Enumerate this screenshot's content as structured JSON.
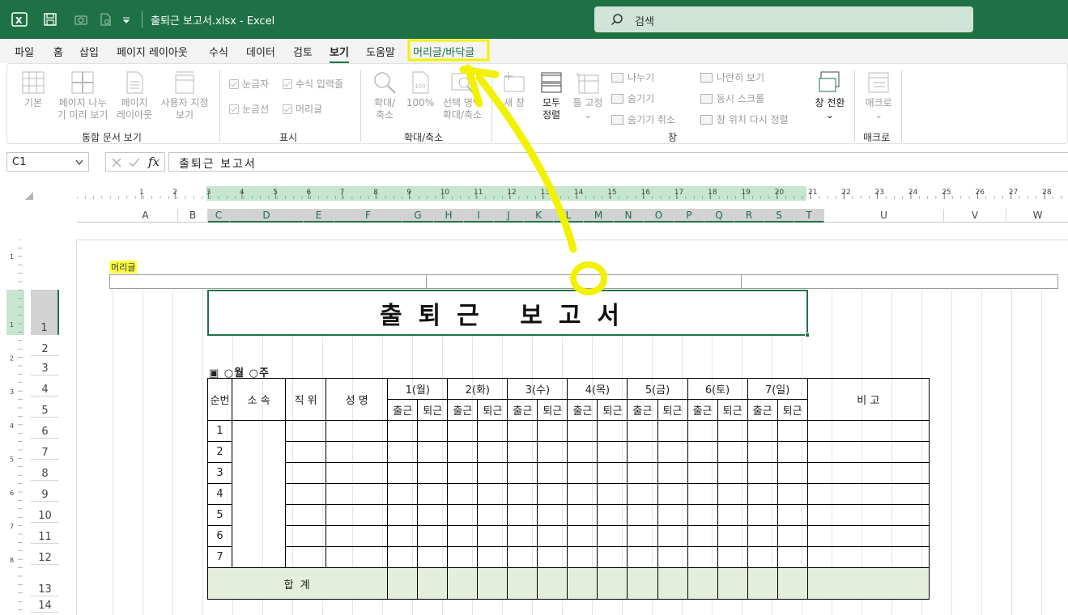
{
  "app": {
    "title": "출퇴근 보고서.xlsx  -  Excel",
    "search_placeholder": "검색"
  },
  "tabs": [
    "파일",
    "홈",
    "삽입",
    "페이지 레이아웃",
    "수식",
    "데이터",
    "검토",
    "보기",
    "도움말",
    "머리글/바닥글"
  ],
  "active_tab": "보기",
  "ribbon": {
    "group_workbook_views": {
      "label": "통합 문서 보기",
      "normal": "기본",
      "page_break_1": "페이지 나누",
      "page_break_2": "기 미리 보기",
      "page_layout_1": "페이지",
      "page_layout_2": "레이아웃",
      "custom_1": "사용자 지정",
      "custom_2": "보기"
    },
    "group_show": {
      "label": "표시",
      "ruler": "눈금자",
      "formula_bar": "수식 입력줄",
      "gridlines": "눈금선",
      "headings": "머리글"
    },
    "group_zoom": {
      "label": "확대/축소",
      "zoom_1": "확대/",
      "zoom_2": "축소",
      "zoom100": "100%",
      "zoom_sel_1": "선택 영역",
      "zoom_sel_2": "확대/축소"
    },
    "group_window": {
      "label": "창",
      "new_window": "새 창",
      "arrange_1": "모두",
      "arrange_2": "정렬",
      "freeze": "틀 고정",
      "split": "나누기",
      "hide": "숨기기",
      "unhide": "숨기기 취소",
      "side_by_side": "나란히 보기",
      "sync_scroll": "동시 스크롤",
      "reset_pos": "창 위치 다시 정렬",
      "switch": "창 전환"
    },
    "group_macro": {
      "label": "매크로",
      "macros": "매크로"
    }
  },
  "formula_bar": {
    "name_box": "C1",
    "formula": "출퇴근   보고서"
  },
  "columns": [
    "A",
    "B",
    "C",
    "D",
    "E",
    "F",
    "G",
    "H",
    "I",
    "J",
    "K",
    "L",
    "M",
    "N",
    "O",
    "P",
    "Q",
    "R",
    "S",
    "T",
    "U",
    "V",
    "W"
  ],
  "ruler_h": [
    "1",
    "2",
    "3",
    "4",
    "5",
    "6",
    "7",
    "8",
    "9",
    "10",
    "11",
    "12",
    "13",
    "14",
    "15",
    "16",
    "17",
    "18",
    "19",
    "20",
    "21",
    "22",
    "23",
    "24",
    "25",
    "26",
    "27",
    "28"
  ],
  "ruler_v": [
    "1",
    "1",
    "2",
    "3",
    "4",
    "5",
    "6",
    "7",
    "8"
  ],
  "rows": [
    "1",
    "2",
    "3",
    "4",
    "5",
    "6",
    "7",
    "8",
    "9",
    "10",
    "11",
    "12",
    "13",
    "14"
  ],
  "sheet": {
    "header_label": "머리글",
    "title": "출퇴근   보고서",
    "week_text": "▣  ○월  ○주",
    "headers": {
      "no": "순번",
      "dept": "소 속",
      "position": "직 위",
      "name": "성    명",
      "remark": "비          고"
    },
    "days": [
      "1(월)",
      "2(화)",
      "3(수)",
      "4(목)",
      "5(금)",
      "6(토)",
      "7(일)"
    ],
    "in_label": "출근",
    "out_label": "퇴근",
    "row_numbers": [
      "1",
      "2",
      "3",
      "4",
      "5",
      "6",
      "7"
    ],
    "total_label": "합    계"
  },
  "colors": {
    "excel_green": "#1e7145",
    "highlight_yellow": "#ffff00",
    "total_fill": "#e3efda"
  }
}
